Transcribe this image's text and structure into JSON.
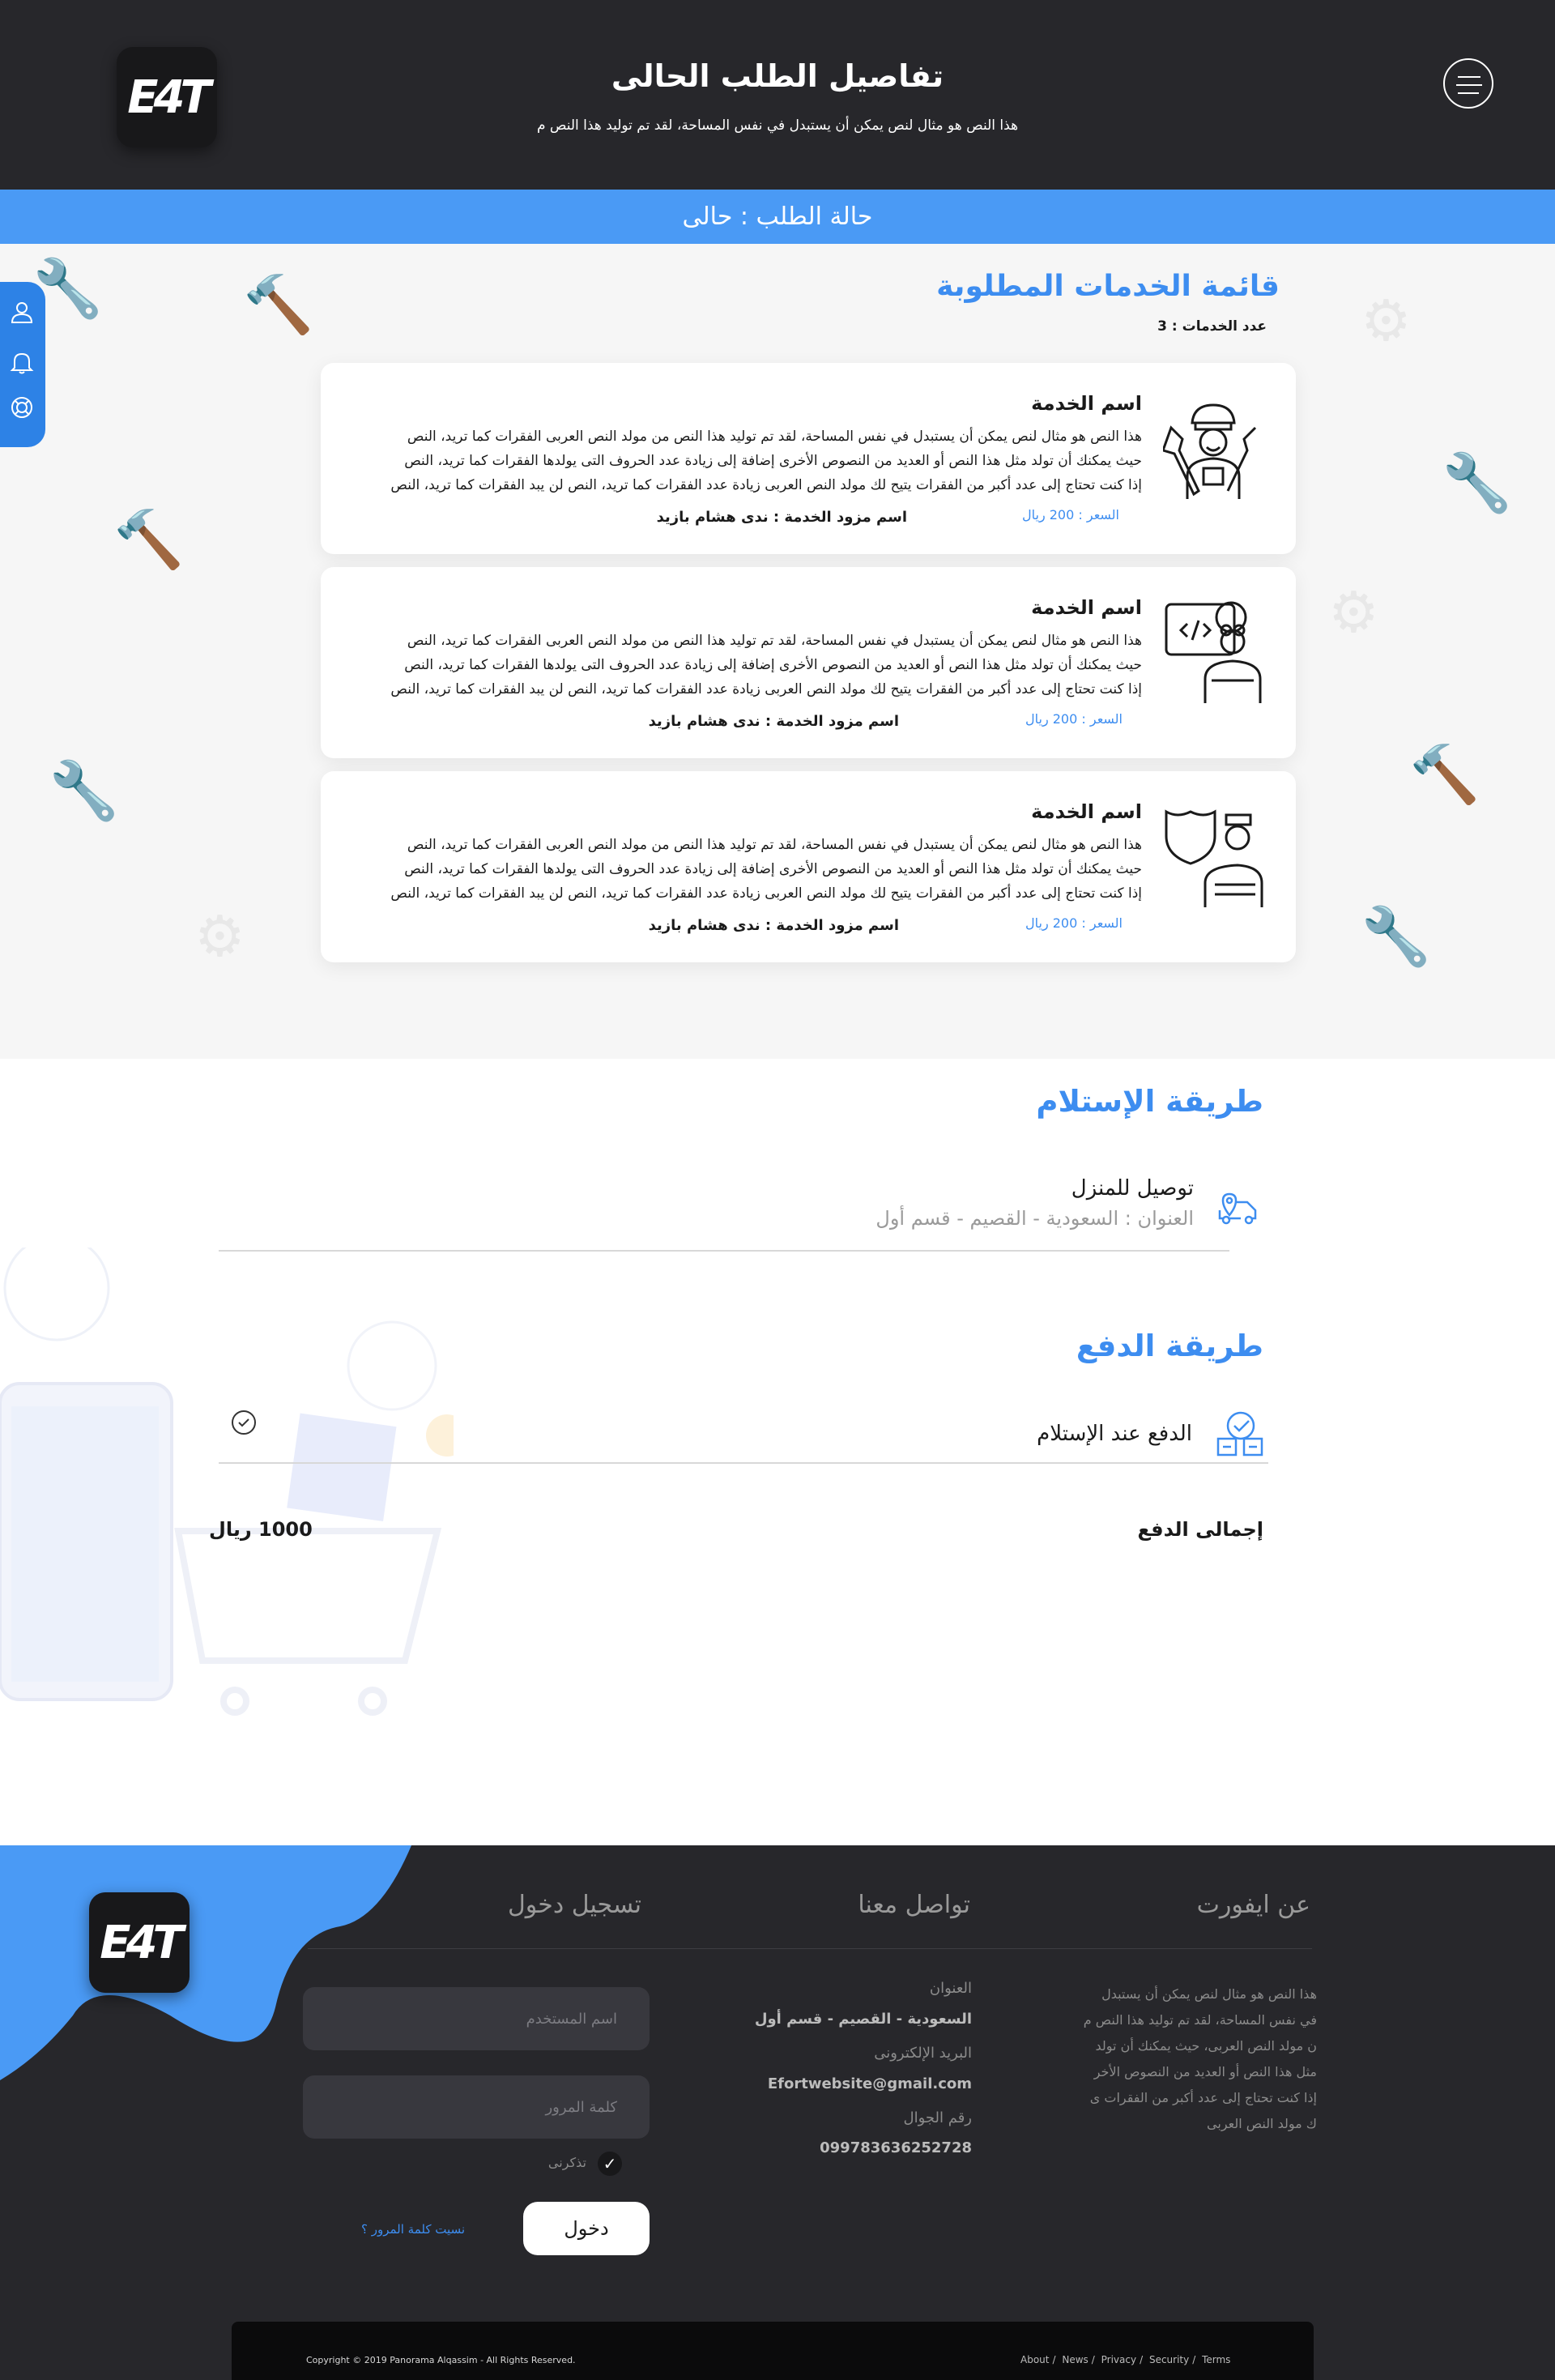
{
  "header": {
    "logo_text": "E4T",
    "title": "تفاصيل الطلب الحالى",
    "subtitle": "هذا النص هو مثال لنص يمكن أن يستبدل في نفس المساحة، لقد تم توليد هذا النص م"
  },
  "status": {
    "text": "حالة الطلب : حالى"
  },
  "services": {
    "title": "قائمة الخدمات المطلوبة",
    "count_text": "عدد الخدمات : 3",
    "items": [
      {
        "name": "اسم الخدمة",
        "desc_lines": [
          "هذا النص هو مثال لنص يمكن أن يستبدل في نفس المساحة، لقد تم توليد هذا النص من مولد النص العربى  الفقرات كما تريد، النص",
          "حيث يمكنك أن تولد مثل هذا النص أو العديد من النصوص الأخرى إضافة إلى زيادة عدد الحروف التى يولدها  الفقرات كما تريد، النص",
          "إذا كنت تحتاج إلى عدد أكبر من الفقرات يتيح لك مولد النص العربى زيادة عدد الفقرات كما تريد، النص لن يبد  الفقرات كما تريد، النص"
        ],
        "price": "السعر : 200 ريال",
        "provider": "اسم مزود الخدمة : ندى هشام بازيد",
        "avatar_icon": "mechanic-icon"
      },
      {
        "name": "اسم الخدمة",
        "desc_lines": [
          "هذا النص هو مثال لنص يمكن أن يستبدل في نفس المساحة، لقد تم توليد هذا النص من مولد النص العربى  الفقرات كما تريد، النص",
          "حيث يمكنك أن تولد مثل هذا النص أو العديد من النصوص الأخرى إضافة إلى زيادة عدد الحروف التى يولدها  الفقرات كما تريد، النص",
          "إذا كنت تحتاج إلى عدد أكبر من الفقرات يتيح لك مولد النص العربى زيادة عدد الفقرات كما تريد، النص لن يبد  الفقرات كما تريد، النص"
        ],
        "price": "السعر : 200 ريال",
        "provider": "اسم مزود الخدمة : ندى هشام بازيد",
        "avatar_icon": "programmer-icon"
      },
      {
        "name": "اسم الخدمة",
        "desc_lines": [
          "هذا النص هو مثال لنص يمكن أن يستبدل في نفس المساحة، لقد تم توليد هذا النص من مولد النص العربى  الفقرات كما تريد، النص",
          "حيث يمكنك أن تولد مثل هذا النص أو العديد من النصوص الأخرى إضافة إلى زيادة عدد الحروف التى يولدها  الفقرات كما تريد، النص",
          "إذا كنت تحتاج إلى عدد أكبر من الفقرات يتيح لك مولد النص العربى زيادة عدد الفقرات كما تريد، النص لن يبد  الفقرات كما تريد، النص"
        ],
        "price": "السعر : 200 ريال",
        "provider": "اسم مزود الخدمة : ندى هشام بازيد",
        "avatar_icon": "security-worker-icon"
      }
    ]
  },
  "side_panel": {
    "icons": [
      "user-icon",
      "bell-icon",
      "support-icon"
    ]
  },
  "delivery": {
    "title": "طريقة الإستلام",
    "method": "توصيل للمنزل",
    "address": "العنوان : السعودية - القصيم - قسم أول",
    "icon": "delivery-truck-icon"
  },
  "payment": {
    "title": "طريقة الدفع",
    "method": "الدفع عند الإستلام",
    "icon": "cash-payment-icon",
    "total_label": "إجمالى الدفع",
    "total_value": "1000 ريال"
  },
  "footer": {
    "logo_text": "E4T",
    "about_title": "عن ايفورت",
    "about_text": "هذا النص هو مثال لنص يمكن أن يستبدل في نفس المساحة، لقد تم توليد هذا النص م ن مولد النص العربى، حيث يمكنك أن تولد مثل هذا النص أو العديد من النصوص الأخر إذا كنت تحتاج إلى عدد أكبر من الفقرات ى ك مولد النص العربى",
    "contact_title": "تواصل معنا",
    "address_label": "العنوان",
    "address_value": "السعودية - القصيم - قسم أول",
    "email_label": "البريد الإلكترونى",
    "email_value": "Efortwebsite@gmail.com",
    "phone_label": "رقم الجوال",
    "phone_value": "099783636252728",
    "login_title": "تسجيل دخول",
    "username_placeholder": "اسم المستخدم",
    "password_placeholder": "كلمة المرور",
    "remember_label": "تذكرنى",
    "login_button": "دخول",
    "forgot_link": "نسيت كلمة المرور ؟",
    "copyright": "Copyright © 2019  Panorama Alqassim -  All Rights Reserved.",
    "links": [
      "About",
      "News",
      "Privacy",
      "Security",
      "Terms"
    ]
  },
  "colors": {
    "header_bg": "#27272b",
    "accent_blue": "#4a9af5",
    "title_blue": "#3d8df0",
    "footer_bg": "#27272b"
  }
}
